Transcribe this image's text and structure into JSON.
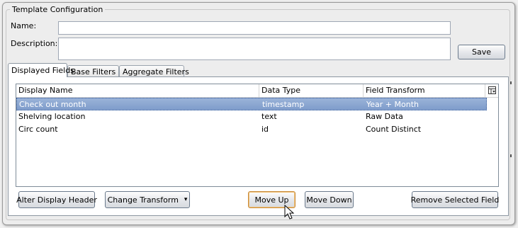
{
  "group": {
    "title": "Template Configuration"
  },
  "form": {
    "name_label": "Name:",
    "name_value": "",
    "description_label": "Description:",
    "description_value": "",
    "save_label": "Save"
  },
  "tabs": [
    {
      "label": "Displayed Fields",
      "active": true
    },
    {
      "label": "Base Filters",
      "active": false
    },
    {
      "label": "Aggregate Filters",
      "active": false
    }
  ],
  "grid": {
    "columns": [
      "Display Name",
      "Data Type",
      "Field Transform"
    ],
    "rows": [
      {
        "display_name": "Check out month",
        "data_type": "timestamp",
        "field_transform": "Year + Month",
        "selected": true
      },
      {
        "display_name": "Shelving location",
        "data_type": "text",
        "field_transform": "Raw Data",
        "selected": false
      },
      {
        "display_name": "Circ count",
        "data_type": "id",
        "field_transform": "Count Distinct",
        "selected": false
      }
    ]
  },
  "actions": {
    "alter_header": "Alter Display Header",
    "change_transform": "Change Transform",
    "dropdown_arrow": "▾",
    "move_up": "Move Up",
    "move_down": "Move Down",
    "remove_field": "Remove Selected Field"
  },
  "colors": {
    "selection": "#8aa6d1",
    "focus_border": "#c88a3a"
  }
}
